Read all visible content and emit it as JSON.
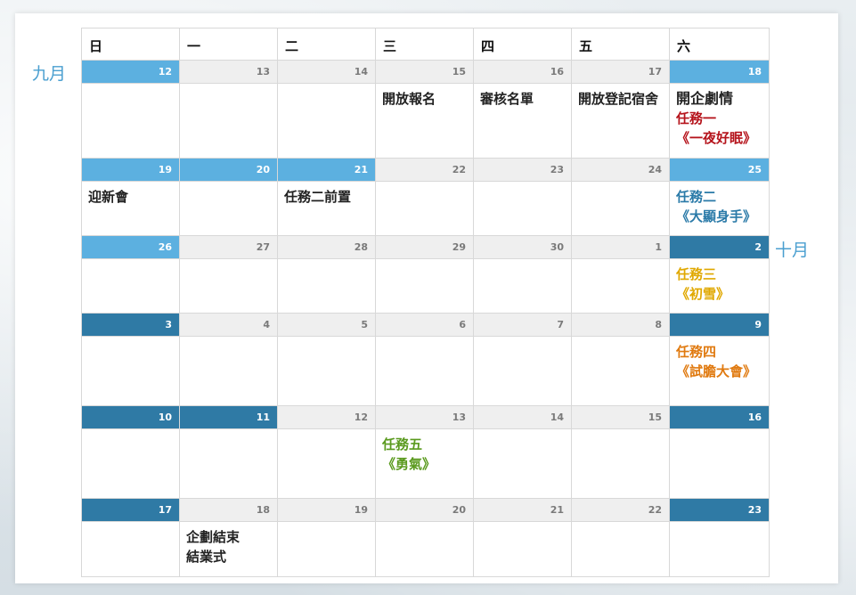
{
  "months": {
    "sep": "九月",
    "oct": "十月"
  },
  "weekdays": [
    "日",
    "一",
    "二",
    "三",
    "四",
    "五",
    "六"
  ],
  "weeks": [
    {
      "dates": [
        "12",
        "13",
        "14",
        "15",
        "16",
        "17",
        "18"
      ],
      "dateStyle": [
        "sep",
        "",
        "",
        "",
        "",
        "",
        "sep"
      ],
      "events": [
        [],
        [],
        [],
        [
          {
            "text": "開放報名",
            "color": "#222222"
          }
        ],
        [
          {
            "text": "審核名單",
            "color": "#222222"
          }
        ],
        [
          {
            "text": "開放登記宿舍",
            "color": "#222222"
          }
        ],
        [
          {
            "text": "開企劇情",
            "color": "#222222"
          },
          {
            "text": "任務一",
            "color": "#b5131b"
          },
          {
            "text": "《一夜好眠》",
            "color": "#b5131b"
          }
        ]
      ]
    },
    {
      "dates": [
        "19",
        "20",
        "21",
        "22",
        "23",
        "24",
        "25"
      ],
      "dateStyle": [
        "sep",
        "sep",
        "sep",
        "",
        "",
        "",
        "sep"
      ],
      "events": [
        [
          {
            "text": "迎新會",
            "color": "#222222"
          }
        ],
        [],
        [
          {
            "text": "任務二前置",
            "color": "#222222"
          }
        ],
        [],
        [],
        [],
        [
          {
            "text": "任務二",
            "color": "#2a7aa8"
          },
          {
            "text": "《大顯身手》",
            "color": "#2a7aa8"
          }
        ]
      ]
    },
    {
      "dates": [
        "26",
        "27",
        "28",
        "29",
        "30",
        "1",
        "2"
      ],
      "dateStyle": [
        "sep",
        "",
        "",
        "",
        "",
        "",
        "oct"
      ],
      "events": [
        [],
        [],
        [],
        [],
        [],
        [],
        [
          {
            "text": "任務三",
            "color": "#e0a800"
          },
          {
            "text": "《初雪》",
            "color": "#e0a800"
          }
        ]
      ]
    },
    {
      "dates": [
        "3",
        "4",
        "5",
        "6",
        "7",
        "8",
        "9"
      ],
      "dateStyle": [
        "oct",
        "",
        "",
        "",
        "",
        "",
        "oct"
      ],
      "events": [
        [],
        [],
        [],
        [],
        [],
        [],
        [
          {
            "text": "任務四",
            "color": "#e07a10"
          },
          {
            "text": "《試膽大會》",
            "color": "#e07a10"
          }
        ]
      ]
    },
    {
      "dates": [
        "10",
        "11",
        "12",
        "13",
        "14",
        "15",
        "16"
      ],
      "dateStyle": [
        "oct",
        "oct",
        "",
        "",
        "",
        "",
        "oct"
      ],
      "events": [
        [],
        [],
        [],
        [
          {
            "text": "任務五",
            "color": "#5a9a1e"
          },
          {
            "text": "《勇氣》",
            "color": "#5a9a1e"
          }
        ],
        [],
        [],
        []
      ]
    },
    {
      "dates": [
        "17",
        "18",
        "19",
        "20",
        "21",
        "22",
        "23"
      ],
      "dateStyle": [
        "oct",
        "",
        "",
        "",
        "",
        "",
        "oct"
      ],
      "events": [
        [],
        [
          {
            "text": "企劃結束",
            "color": "#222222"
          },
          {
            "text": "結業式",
            "color": "#222222"
          }
        ],
        [],
        [],
        [],
        [],
        []
      ]
    }
  ]
}
